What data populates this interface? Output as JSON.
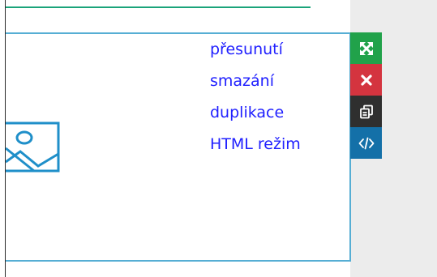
{
  "menu": {
    "move": "přesunutí",
    "delete": "smazání",
    "duplicate": "duplikace",
    "html_mode": "HTML režim"
  },
  "toolbar": {
    "move_icon": "move-arrows-icon",
    "delete_icon": "close-icon",
    "duplicate_icon": "copy-icon",
    "html_icon": "code-icon"
  },
  "colors": {
    "move": "#21a24a",
    "delete": "#d4343f",
    "duplicate": "#2f2f2f",
    "html": "#1470a8",
    "link": "#2020ff",
    "border": "#56aed4"
  }
}
